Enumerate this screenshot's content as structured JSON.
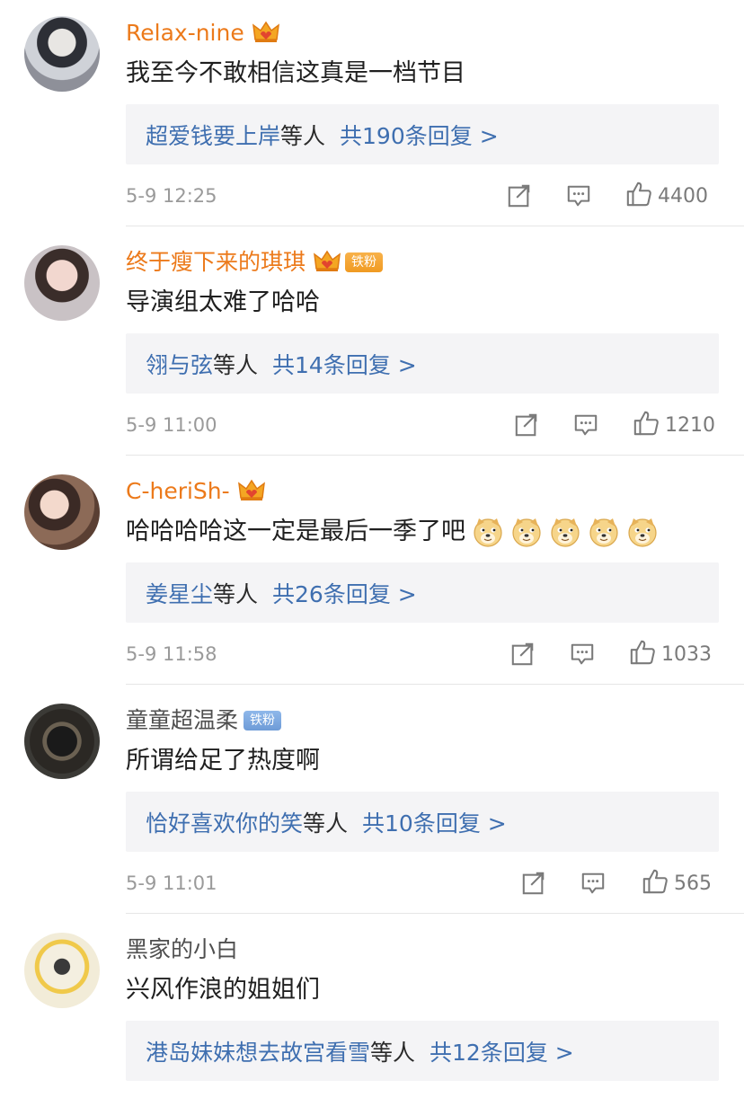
{
  "comments": [
    {
      "user": "Relax-nine",
      "name_style": "vip",
      "crown": true,
      "badge": "",
      "text": "我至今不敢相信这真是一档节目",
      "emoji_count": 0,
      "reply_names": "超爱钱要上岸",
      "reply_mid": "等人",
      "reply_count": "共190条回复 >",
      "time": "5-9 12:25",
      "likes": "4400"
    },
    {
      "user": "终于瘦下来的琪琪",
      "name_style": "vip",
      "crown": true,
      "badge": "铁粉",
      "badge_color": "orange",
      "text": "导演组太难了哈哈",
      "emoji_count": 0,
      "reply_names": "翎与弦",
      "reply_mid": "等人",
      "reply_count": "共14条回复 >",
      "time": "5-9 11:00",
      "likes": "1210"
    },
    {
      "user": "C-heriSh-",
      "name_style": "vip",
      "crown": true,
      "badge": "",
      "text": "哈哈哈哈这一定是最后一季了吧",
      "emoji_count": 5,
      "emoji": "doge-emoji",
      "reply_names": "姜星尘",
      "reply_mid": "等人",
      "reply_count": "共26条回复 >",
      "time": "5-9 11:58",
      "likes": "1033"
    },
    {
      "user": "童童超温柔",
      "name_style": "normal",
      "crown": false,
      "badge": "铁粉",
      "badge_color": "blue",
      "text": "所谓给足了热度啊",
      "emoji_count": 0,
      "reply_names": "恰好喜欢你的笑",
      "reply_mid": "等人",
      "reply_count": "共10条回复 >",
      "time": "5-9 11:01",
      "likes": "565"
    },
    {
      "user": "黑家的小白",
      "name_style": "normal",
      "crown": false,
      "badge": "",
      "text": "兴风作浪的姐姐们",
      "emoji_count": 0,
      "reply_names": "港岛妹妹想去故宫看雪",
      "reply_mid": "等人",
      "reply_count": "共12条回复 >",
      "time": "",
      "likes": ""
    }
  ],
  "icons": {
    "share": "share-icon",
    "comment": "comment-icon",
    "like": "thumbs-up-icon",
    "crown": "crown-icon"
  },
  "colors": {
    "vip_name": "#ec7a1b",
    "link": "#3f6fb0",
    "reply_bg": "#f4f4f6",
    "meta": "#9a9a9a"
  }
}
